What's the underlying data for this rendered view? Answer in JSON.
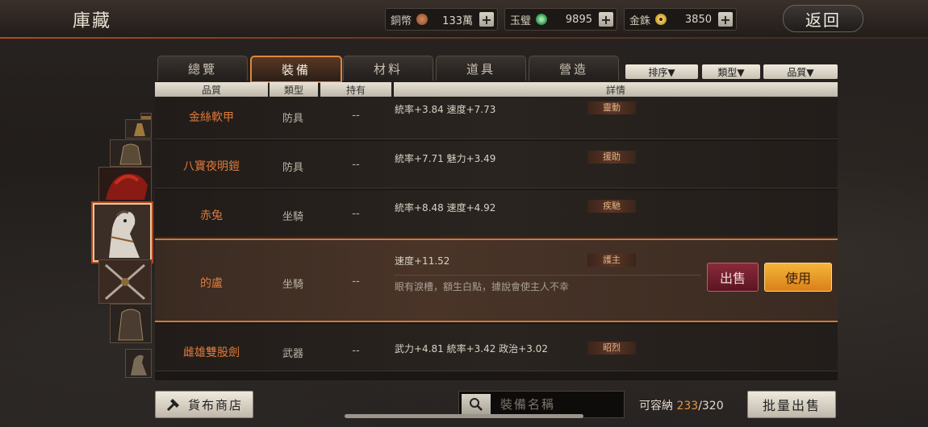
{
  "header": {
    "title": "庫藏",
    "back_label": "返回"
  },
  "currencies": [
    {
      "name": "銅幣",
      "value": "133萬",
      "icon": "copper-coin-icon",
      "color": "#b36a3a"
    },
    {
      "name": "玉璧",
      "value": "9895",
      "icon": "jade-disc-icon",
      "color": "#3aa05a"
    },
    {
      "name": "金銖",
      "value": "3850",
      "icon": "gold-coin-icon",
      "color": "#d6a82a"
    }
  ],
  "plus_label": "+",
  "tabs": [
    {
      "label": "總覽",
      "active": false
    },
    {
      "label": "裝備",
      "active": true
    },
    {
      "label": "材料",
      "active": false
    },
    {
      "label": "道具",
      "active": false
    },
    {
      "label": "營造",
      "active": false
    }
  ],
  "sort_buttons": [
    "排序▼",
    "類型▼",
    "品質▼"
  ],
  "columns": [
    "品質",
    "類型",
    "持有",
    "詳情"
  ],
  "rows": [
    {
      "name": "金絲軟甲",
      "type": "防具",
      "own": "--",
      "stats": "統率+3.84  速度+7.73",
      "skill": "靈動"
    },
    {
      "name": "八寶夜明鎧",
      "type": "防具",
      "own": "--",
      "stats": "統率+7.71  魅力+3.49",
      "skill": "援助"
    },
    {
      "name": "赤兔",
      "type": "坐騎",
      "own": "--",
      "stats": "統率+8.48  速度+4.92",
      "skill": "疾馳"
    },
    {
      "name": "的盧",
      "type": "坐騎",
      "own": "--",
      "stats": "速度+11.52",
      "skill": "護主",
      "desc": "眼有淚槽，額生白點，據說會使主人不幸",
      "selected": true
    },
    {
      "name": "雌雄雙股劍",
      "type": "武器",
      "own": "--",
      "stats": "武力+4.81  統率+3.42  政治+3.02",
      "skill": "昭烈"
    }
  ],
  "actions": {
    "sell": "出售",
    "use": "使用"
  },
  "bottom": {
    "shop_label": "貨布商店",
    "search_placeholder": "裝備名稱",
    "capacity_label": "可容納",
    "capacity_used": "233",
    "capacity_total": "/320",
    "bulk_sell": "批量出售"
  }
}
